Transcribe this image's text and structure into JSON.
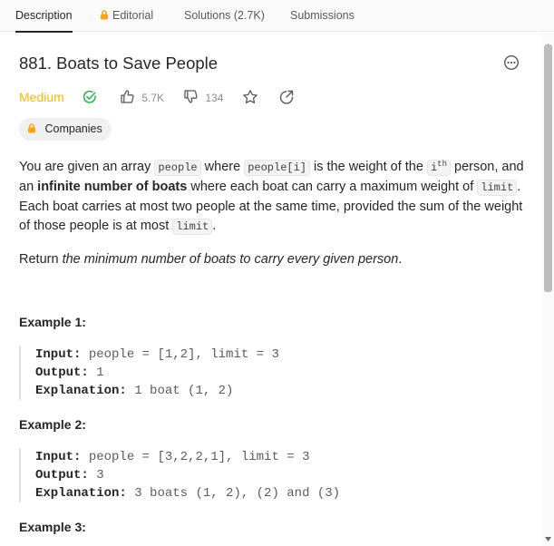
{
  "tabs": {
    "description": "Description",
    "editorial": "Editorial",
    "solutions": "Solutions (2.7K)",
    "submissions": "Submissions"
  },
  "problem": {
    "title": "881. Boats to Save People",
    "difficulty": "Medium",
    "likes": "5.7K",
    "dislikes": "134",
    "companies": "Companies"
  },
  "description": {
    "p1": {
      "t1": "You are given an array ",
      "c1": "people",
      "t2": " where ",
      "c2": "people[i]",
      "t3": " is the weight of the ",
      "c3_base": "i",
      "c3_sup": "th",
      "t4": " person, and an ",
      "b1": "infinite number of boats",
      "t5": " where each boat can carry a maximum weight of ",
      "c4": "limit",
      "t6": ". Each boat carries at most two people at the same time, provided the sum of the weight of those people is at most ",
      "c5": "limit",
      "t7": "."
    },
    "p2": {
      "t1": "Return ",
      "i1": "the minimum number of boats to carry every given person",
      "t2": "."
    }
  },
  "examples": [
    {
      "title": "Example 1:",
      "input_label": "Input:",
      "input": "people = [1,2], limit = 3",
      "output_label": "Output:",
      "output": "1",
      "explanation_label": "Explanation:",
      "explanation": "1 boat (1, 2)"
    },
    {
      "title": "Example 2:",
      "input_label": "Input:",
      "input": "people = [3,2,2,1], limit = 3",
      "output_label": "Output:",
      "output": "3",
      "explanation_label": "Explanation:",
      "explanation": "3 boats (1, 2), (2) and (3)"
    },
    {
      "title": "Example 3:"
    }
  ],
  "colors": {
    "medium": "#ffb800",
    "solved": "#2db55d",
    "lock": "#ffa116"
  },
  "icons": [
    "lock-icon",
    "more-icon",
    "solved-check-icon",
    "thumbs-up-icon",
    "thumbs-down-icon",
    "star-icon",
    "share-icon"
  ]
}
